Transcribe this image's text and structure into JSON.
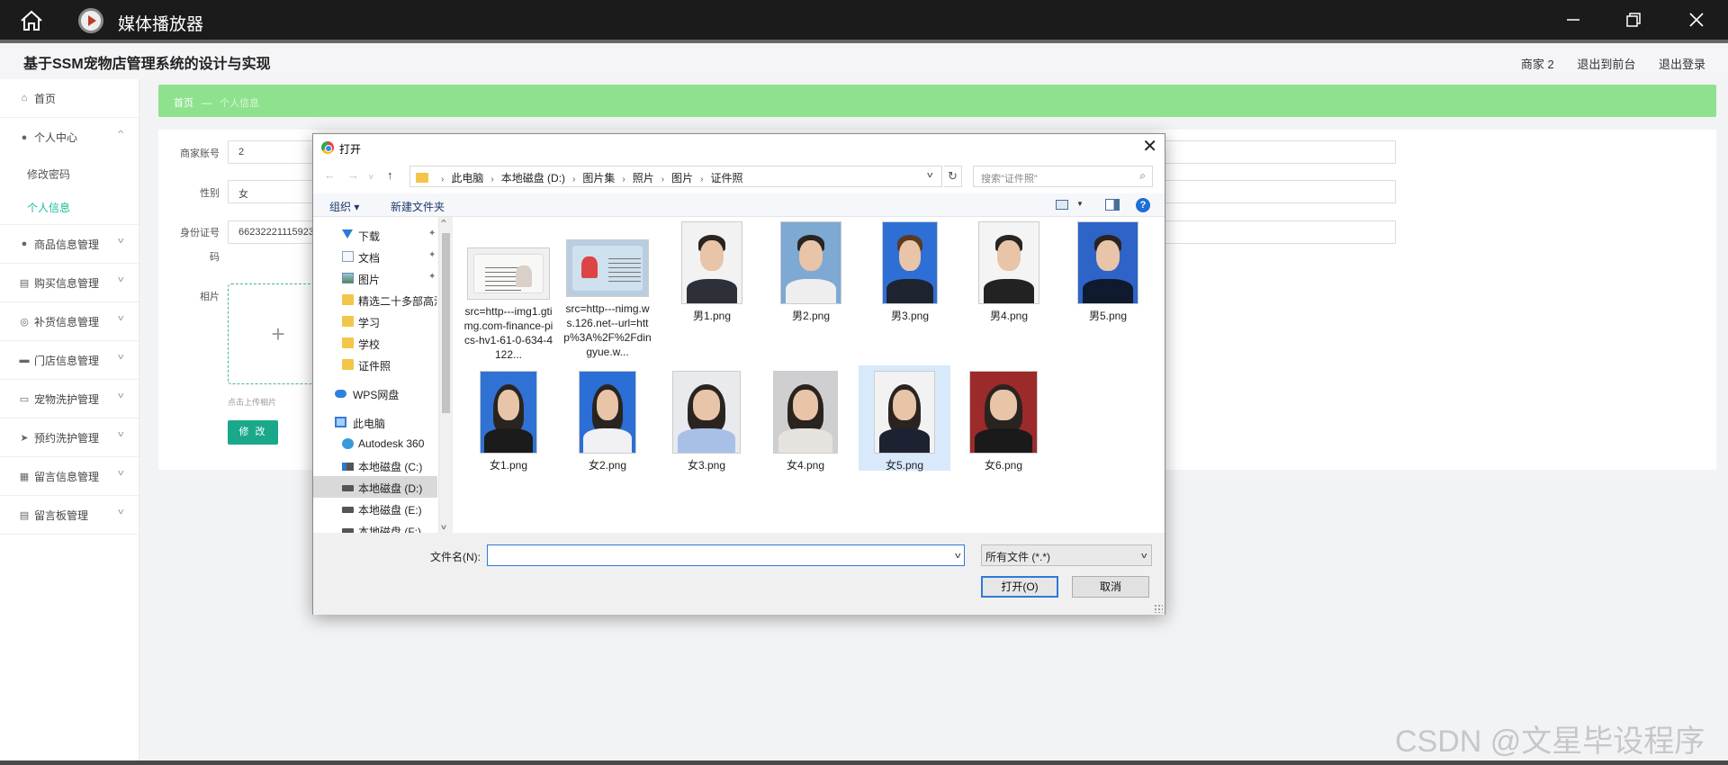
{
  "player": {
    "title": "媒体播放器"
  },
  "app": {
    "title": "基于SSM宠物店管理系统的设计与实现",
    "header_links": [
      "商家 2",
      "退出到前台",
      "退出登录"
    ]
  },
  "sidebar": {
    "items": [
      {
        "label": "首页",
        "icon": "home-icon"
      },
      {
        "label": "个人中心",
        "icon": "user-icon",
        "expanded": true,
        "children": [
          {
            "label": "修改密码",
            "active": false
          },
          {
            "label": "个人信息",
            "active": true
          }
        ]
      },
      {
        "label": "商品信息管理",
        "icon": "user-icon"
      },
      {
        "label": "购买信息管理",
        "icon": "doc-icon"
      },
      {
        "label": "补货信息管理",
        "icon": "compass-icon"
      },
      {
        "label": "门店信息管理",
        "icon": "chat-icon"
      },
      {
        "label": "宠物洗护管理",
        "icon": "monitor-icon"
      },
      {
        "label": "预约洗护管理",
        "icon": "send-icon"
      },
      {
        "label": "留言信息管理",
        "icon": "shop-icon"
      },
      {
        "label": "留言板管理",
        "icon": "doc-icon"
      }
    ]
  },
  "breadcrumb": {
    "home": "首页",
    "separator": "—",
    "current": "个人信息"
  },
  "form": {
    "account_label": "商家账号",
    "account_value": "2",
    "gender_label": "性别",
    "gender_value": "女",
    "id_label_1": "身份证号",
    "id_label_2": "码",
    "id_value": "662322211159232",
    "photo_label": "相片",
    "upload_plus": "+",
    "upload_hint": "点击上传相片",
    "edit_button": "修 改"
  },
  "dialog": {
    "title": "打开",
    "close": "✕",
    "address": [
      "此电脑",
      "本地磁盘 (D:)",
      "图片集",
      "照片",
      "图片",
      "证件照"
    ],
    "search_placeholder": "搜索\"证件照\"",
    "toolbar": {
      "organize": "组织 ▾",
      "new_folder": "新建文件夹",
      "help": "?"
    },
    "nav_items": [
      {
        "label": "下载",
        "icon": "download-icon",
        "pinned": true
      },
      {
        "label": "文档",
        "icon": "document-icon",
        "pinned": true
      },
      {
        "label": "图片",
        "icon": "pictures-icon",
        "pinned": true
      },
      {
        "label": "精选二十多部高清",
        "icon": "folder-icon"
      },
      {
        "label": "学习",
        "icon": "folder-icon"
      },
      {
        "label": "学校",
        "icon": "folder-icon"
      },
      {
        "label": "证件照",
        "icon": "folder-icon"
      },
      {
        "label": "WPS网盘",
        "icon": "cloud-icon"
      },
      {
        "label": "此电脑",
        "icon": "computer-icon"
      },
      {
        "label": "Autodesk 360",
        "icon": "autodesk-icon"
      },
      {
        "label": "本地磁盘 (C:)",
        "icon": "system-drive-icon"
      },
      {
        "label": "本地磁盘 (D:)",
        "icon": "drive-icon",
        "selected": true
      },
      {
        "label": "本地磁盘 (E:)",
        "icon": "drive-icon"
      },
      {
        "label": "本地磁盘 (F:)",
        "icon": "drive-icon"
      }
    ],
    "files": [
      {
        "name": "src=http---img1.gtimg.com-finance-pics-hv1-61-0-634-4122...",
        "kind": "id-card"
      },
      {
        "name": "src=http---nimg.ws.126.net--url=http%3A%2F%2Fdingyue.w...",
        "kind": "id-card-blue"
      },
      {
        "name": "男1.png",
        "kind": "portrait"
      },
      {
        "name": "男2.png",
        "kind": "portrait"
      },
      {
        "name": "男3.png",
        "kind": "portrait"
      },
      {
        "name": "男4.png",
        "kind": "portrait"
      },
      {
        "name": "男5.png",
        "kind": "portrait"
      },
      {
        "name": "女1.png",
        "kind": "portrait"
      },
      {
        "name": "女2.png",
        "kind": "portrait"
      },
      {
        "name": "女3.png",
        "kind": "portrait"
      },
      {
        "name": "女4.png",
        "kind": "portrait"
      },
      {
        "name": "女5.png",
        "kind": "portrait",
        "selected": true
      },
      {
        "name": "女6.png",
        "kind": "portrait"
      }
    ],
    "filename_label": "文件名(N):",
    "filename_value": "",
    "filetype_value": "所有文件 (*.*)",
    "open_button": "打开(O)",
    "cancel_button": "取消"
  },
  "watermark": "CSDN @文星毕设程序",
  "colors": {
    "accent": "#1aa88a",
    "breadcrumb_bg": "#8ee28e",
    "dialog_selection": "#d7e9fb",
    "player_bar": "#1b1b1b"
  }
}
